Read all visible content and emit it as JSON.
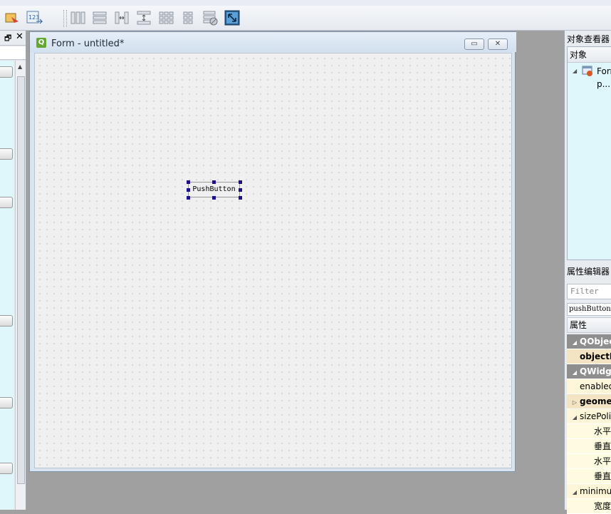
{
  "toolbar": {
    "buttons": [
      "edit-signals-icon",
      "tab-order-icon",
      "layout-horizontal-icon",
      "layout-vertical-icon",
      "layout-h-splitter-icon",
      "layout-v-splitter-icon",
      "layout-grid-icon",
      "layout-form-icon",
      "break-layout-icon",
      "adjust-size-icon"
    ]
  },
  "form_window": {
    "title": "Form - untitled*",
    "minimize_glyph": "▭",
    "close_glyph": "✕",
    "push_button_label": "PushButton"
  },
  "object_inspector": {
    "title": "对象查看器",
    "column_header": "对象",
    "items": [
      "Form",
      "p..."
    ]
  },
  "property_editor": {
    "title": "属性编辑器",
    "filter_placeholder": "Filter",
    "object_class": "pushButton : QPushButton",
    "column_header": "属性",
    "rows": [
      {
        "label": "QObject",
        "kind": "group",
        "arrow": "◢"
      },
      {
        "label": "objectName",
        "kind": "bold",
        "arrow": ""
      },
      {
        "label": "QWidget",
        "kind": "group",
        "arrow": "◢"
      },
      {
        "label": "enabled",
        "kind": "normal",
        "arrow": ""
      },
      {
        "label": "geometry",
        "kind": "bold",
        "arrow": "▷"
      },
      {
        "label": "sizePolicy",
        "kind": "normal",
        "arrow": "◢"
      },
      {
        "label": "水平策略",
        "kind": "child",
        "arrow": ""
      },
      {
        "label": "垂直策略",
        "kind": "child",
        "arrow": ""
      },
      {
        "label": "水平伸展",
        "kind": "child",
        "arrow": ""
      },
      {
        "label": "垂直伸展",
        "kind": "child",
        "arrow": ""
      },
      {
        "label": "minimumSize",
        "kind": "normal",
        "arrow": "◢"
      },
      {
        "label": "宽度",
        "kind": "child",
        "arrow": ""
      }
    ]
  },
  "colors": {
    "group_row": "#8e8e8e",
    "object_row": "#f3e5c3",
    "normal_row": "#fef6d8",
    "child_row": "#fefbe0",
    "panel_bg": "#dff7fb"
  }
}
